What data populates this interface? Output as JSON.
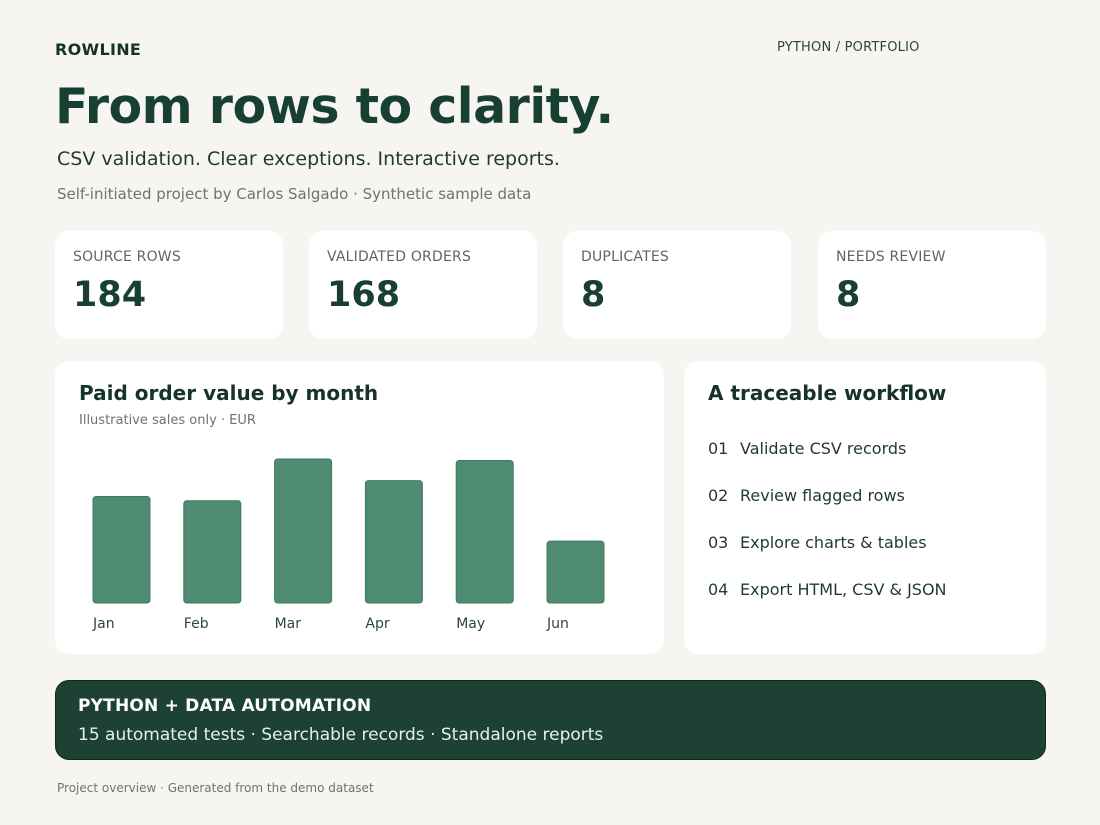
{
  "header": {
    "brand": "ROWLINE",
    "crumb": "PYTHON / PORTFOLIO"
  },
  "hero": {
    "title": "From rows to clarity.",
    "subtitle": "CSV validation. Clear exceptions. Interactive reports.",
    "credit": "Self-initiated project by Carlos Salgado · Synthetic sample data"
  },
  "stats": [
    {
      "label": "SOURCE ROWS",
      "value": "184"
    },
    {
      "label": "VALIDATED ORDERS",
      "value": "168"
    },
    {
      "label": "DUPLICATES",
      "value": "8"
    },
    {
      "label": "NEEDS REVIEW",
      "value": "8"
    }
  ],
  "chart_card": {
    "title": "Paid order value by month",
    "subtitle": "Illustrative sales only · EUR"
  },
  "chart_data": {
    "type": "bar",
    "title": "Paid order value by month",
    "subtitle": "Illustrative sales only · EUR",
    "categories": [
      "Jan",
      "Feb",
      "Mar",
      "Apr",
      "May",
      "Jun"
    ],
    "values": [
      74,
      71,
      100,
      85,
      99,
      43
    ],
    "ylim": [
      0,
      100
    ],
    "grid": false,
    "color": "#4e8b70"
  },
  "workflow": {
    "title": "A traceable workflow",
    "steps": [
      {
        "num": "01",
        "label": "Validate CSV records"
      },
      {
        "num": "02",
        "label": "Review flagged rows"
      },
      {
        "num": "03",
        "label": "Explore charts & tables"
      },
      {
        "num": "04",
        "label": "Export HTML, CSV & JSON"
      }
    ]
  },
  "banner": {
    "title": "PYTHON + DATA AUTOMATION",
    "text": "15 automated tests · Searchable records · Standalone reports"
  },
  "footer": {
    "text": "Project overview · Generated from the demo dataset"
  },
  "colors": {
    "accent": "#173f32",
    "bar": "#4e8b70",
    "banner": "#1d4234",
    "background": "#f7f5f1"
  }
}
